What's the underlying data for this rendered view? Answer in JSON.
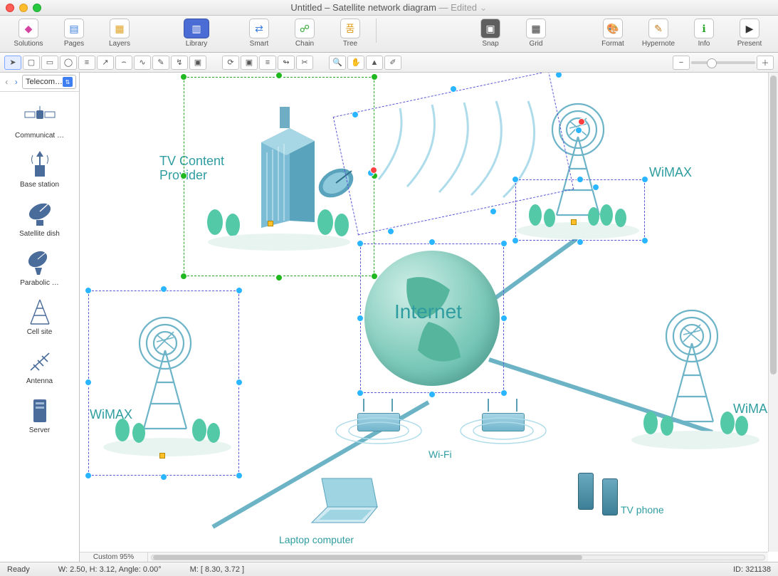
{
  "window": {
    "title_prefix": "Untitled",
    "title_doc": "Satellite network diagram",
    "edited_label": "Edited"
  },
  "toolbar": {
    "left": [
      {
        "id": "solutions",
        "label": "Solutions",
        "glyph": "◆"
      },
      {
        "id": "pages",
        "label": "Pages",
        "glyph": "▤"
      },
      {
        "id": "layers",
        "label": "Layers",
        "glyph": "▦"
      }
    ],
    "left2": [
      {
        "id": "library",
        "label": "Library",
        "glyph": "▥"
      }
    ],
    "center": [
      {
        "id": "smart",
        "label": "Smart",
        "glyph": "⇄"
      },
      {
        "id": "chain",
        "label": "Chain",
        "glyph": "⛓"
      },
      {
        "id": "tree",
        "label": "Tree",
        "glyph": "⌘"
      }
    ],
    "center2": [
      {
        "id": "snap",
        "label": "Snap",
        "glyph": "◉"
      },
      {
        "id": "grid",
        "label": "Grid",
        "glyph": "▦"
      }
    ],
    "right": [
      {
        "id": "format",
        "label": "Format",
        "glyph": "🎨"
      },
      {
        "id": "hypernote",
        "label": "Hypernote",
        "glyph": "✎"
      },
      {
        "id": "info",
        "label": "Info",
        "glyph": "ℹ"
      },
      {
        "id": "present",
        "label": "Present",
        "glyph": "▶"
      }
    ]
  },
  "iconbar": {
    "tools": [
      "pointer",
      "marquee",
      "rect",
      "ellipse",
      "text",
      "line",
      "curve",
      "bezier",
      "pen",
      "connect",
      "stamp"
    ],
    "edit": [
      "rotate",
      "group",
      "align",
      "join",
      "split"
    ],
    "view": [
      "zoom-tool",
      "pan",
      "eyedrop",
      "pipette"
    ],
    "zoom": {
      "out": "–",
      "in": "+",
      "value": 95
    }
  },
  "sidebar": {
    "selector_label": "Telecom…",
    "items": [
      {
        "id": "communications-satellite",
        "label": "Communicat …"
      },
      {
        "id": "base-station",
        "label": "Base station"
      },
      {
        "id": "satellite-dish",
        "label": "Satellite dish"
      },
      {
        "id": "parabolic",
        "label": "Parabolic …"
      },
      {
        "id": "cell-site",
        "label": "Cell site"
      },
      {
        "id": "antenna",
        "label": "Antenna"
      },
      {
        "id": "server",
        "label": "Server"
      }
    ]
  },
  "canvas": {
    "nodes": {
      "tv_provider": "TV Content\nProvider",
      "internet": "Internet",
      "wimax": "WiMAX",
      "wifi": "Wi-Fi",
      "laptop": "Laptop computer",
      "tvphone": "TV phone"
    },
    "status": {
      "ready": "Ready",
      "size": "W: 2.50,  H: 3.12,  Angle: 0.00°",
      "mouse": "M: [ 8.30, 3.72 ]",
      "id": "ID: 321138",
      "zoom": "Custom 95%"
    }
  }
}
